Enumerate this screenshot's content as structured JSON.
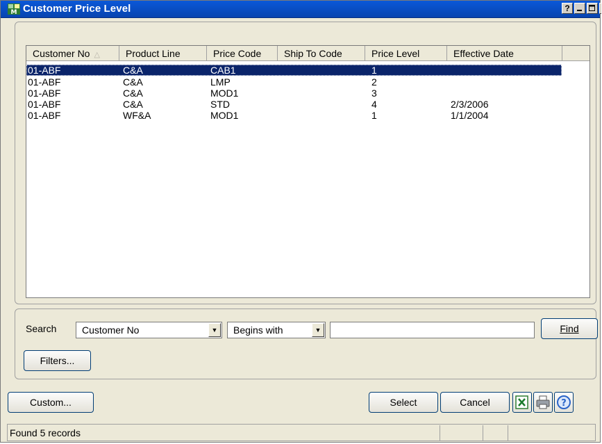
{
  "window": {
    "title": "Customer Price Level",
    "help": "?"
  },
  "grid": {
    "columns": [
      {
        "label": "Customer No",
        "sorted": true
      },
      {
        "label": "Product Line"
      },
      {
        "label": "Price Code"
      },
      {
        "label": "Ship To Code"
      },
      {
        "label": "Price Level"
      },
      {
        "label": "Effective Date"
      }
    ],
    "rows": [
      {
        "customer_no": "01-ABF",
        "product_line": "C&A",
        "price_code": "CAB1",
        "ship_to": "",
        "price_level": "1",
        "effective_date": "",
        "selected": true
      },
      {
        "customer_no": "01-ABF",
        "product_line": "C&A",
        "price_code": "LMP",
        "ship_to": "",
        "price_level": "2",
        "effective_date": ""
      },
      {
        "customer_no": "01-ABF",
        "product_line": "C&A",
        "price_code": "MOD1",
        "ship_to": "",
        "price_level": "3",
        "effective_date": ""
      },
      {
        "customer_no": "01-ABF",
        "product_line": "C&A",
        "price_code": "STD",
        "ship_to": "",
        "price_level": "4",
        "effective_date": "2/3/2006"
      },
      {
        "customer_no": "01-ABF",
        "product_line": "WF&A",
        "price_code": "MOD1",
        "ship_to": "",
        "price_level": "1",
        "effective_date": "1/1/2004"
      }
    ]
  },
  "search": {
    "label": "Search",
    "field": "Customer No",
    "operator": "Begins with",
    "value": "",
    "find_label": "Find",
    "filters_label": "Filters..."
  },
  "footer": {
    "custom_label": "Custom...",
    "select_label": "Select",
    "cancel_label": "Cancel"
  },
  "status": {
    "text": "Found 5 records"
  },
  "colors": {
    "title_bar": "#0a58d8",
    "selection": "#0a246a",
    "window_bg": "#ece9d8"
  }
}
